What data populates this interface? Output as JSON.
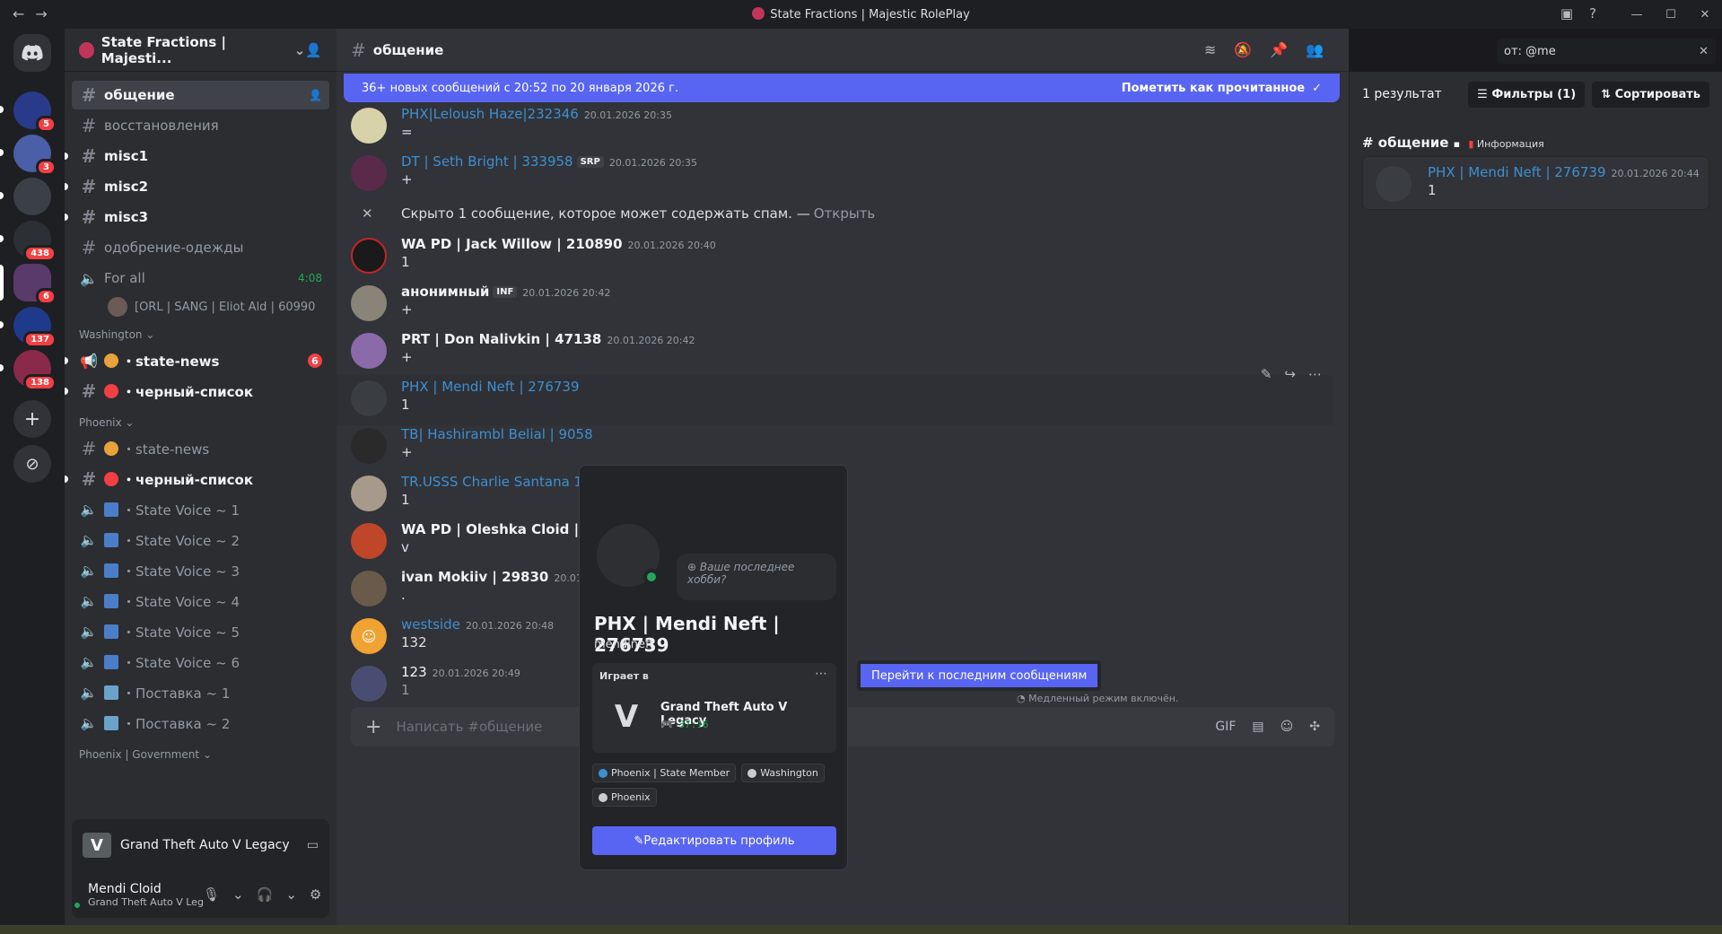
{
  "window": {
    "title": "State Fractions | Majestic RolePlay",
    "back_icon": "←",
    "forward_icon": "→",
    "minimize": "—",
    "maximize": "☐",
    "close": "✕"
  },
  "guilds": [
    {
      "badge": "5"
    },
    {
      "badge": "3"
    },
    {
      "badge": ""
    },
    {
      "badge": "438"
    },
    {
      "badge": "6"
    },
    {
      "badge": "137"
    },
    {
      "badge": "138"
    }
  ],
  "server": {
    "name": "State Fractions | Majesti...",
    "brand_color": "#c0365a"
  },
  "channels": {
    "top": [
      {
        "name": "общение",
        "state": "active"
      },
      {
        "name": "восстановления",
        "state": "read"
      },
      {
        "name": "misc1",
        "state": "unread"
      },
      {
        "name": "misc2",
        "state": "unread"
      },
      {
        "name": "misc3",
        "state": "unread"
      },
      {
        "name": "одобрение-одежды",
        "state": "read"
      }
    ],
    "voice_for_all": {
      "name": "For all",
      "timer": "4:08"
    },
    "voice_user": "[ORL | SANG | Eliot Ald | 60990",
    "cat_washington": "Washington",
    "washington": [
      {
        "name": "・state-news",
        "badge": "6"
      },
      {
        "name": "・черный-список",
        "badge": ""
      }
    ],
    "cat_phoenix": "Phoenix",
    "phoenix": [
      {
        "name": "・state-news"
      },
      {
        "name": "・черный-список"
      },
      {
        "name": "・State Voice ~ 1"
      },
      {
        "name": "・State Voice ~ 2"
      },
      {
        "name": "・State Voice ~ 3"
      },
      {
        "name": "・State Voice ~ 4"
      },
      {
        "name": "・State Voice ~ 5"
      },
      {
        "name": "・State Voice ~ 6"
      },
      {
        "name": "・Поставка ~ 1"
      },
      {
        "name": "・Поставка ~ 2"
      }
    ],
    "cat_phoenix_gov": "Phoenix | Government"
  },
  "activity_panel": {
    "game": "Grand Theft Auto V Legacy"
  },
  "user_panel": {
    "name": "Mendi Cloid",
    "status": "Grand Theft Auto V Leg"
  },
  "chat": {
    "channel": "общение",
    "new_banner": "36+ новых сообщений с 20:52 по 20 января 2026 г.",
    "mark_read": "Пометить как прочитанное",
    "messages": [
      {
        "author": "PHX|Leloush Haze|232346",
        "ts": "20.01.2026 20:35",
        "body": "=",
        "tag": ""
      },
      {
        "author": "DT | Seth Bright | 333958",
        "ts": "20.01.2026 20:35",
        "body": "+",
        "tag": "SRP"
      },
      {
        "author": "WA PD | Jack Willow | 210890",
        "ts": "20.01.2026 20:40",
        "body": "1",
        "tag": ""
      },
      {
        "author": "анонимный",
        "ts": "20.01.2026 20:42",
        "body": "+",
        "tag": "INF"
      },
      {
        "author": "PRT | Don Nalivkin | 47138",
        "ts": "20.01.2026 20:42",
        "body": "+",
        "tag": ""
      },
      {
        "author": "PHX   | Mendi Neft  | 276739",
        "ts": "",
        "body": "1",
        "tag": ""
      },
      {
        "author": "TB| Hashirambl Belial | 9058",
        "ts": "",
        "body": "+",
        "tag": ""
      },
      {
        "author": "TR.USSS Charlie Santana 182",
        "ts": "",
        "body": "1",
        "tag": ""
      },
      {
        "author": "WA PD | Oleshka Cloid | 1272",
        "ts": "",
        "body": "v",
        "tag": ""
      },
      {
        "author": "ivan Mokiiv | 29830",
        "ts": "20.01.2026",
        "body": ".",
        "tag": ""
      },
      {
        "author": "westside",
        "ts": "20.01.2026 20:48",
        "body": "132",
        "tag": ""
      },
      {
        "author": "123",
        "ts": "20.01.2026 20:49",
        "body": "1",
        "tag": ""
      }
    ],
    "spam_notice": "Скрыто 1 сообщение, которое может содержать спам. —",
    "spam_open": "Открыть",
    "slowmode": "Медленный режим включён.",
    "composer_placeholder": "Написать #общение",
    "jump_button": "Перейти к последним сообщениям"
  },
  "search": {
    "query": "от: @me",
    "results_count": "1 результат",
    "filters": "Фильтры (1)",
    "sort": "Сортировать",
    "result_channel": "общение",
    "result_category": "Информация",
    "result": {
      "author": "PHX   | Mendi Neft  | 276739",
      "ts": "20.01.2026 20:44",
      "body": "1"
    }
  },
  "profile": {
    "hobby": "Ваше последнее хобби?",
    "display_name": "PHX | Mendi Neft | 276739",
    "username": "mendineft",
    "playing_label": "Играет в",
    "game": "Grand Theft Auto V Legacy",
    "game_time": "37:16",
    "roles": [
      {
        "name": "Phoenix | State Member",
        "color": "#3e8fd0"
      },
      {
        "name": "Washington",
        "color": "#c9cdd2"
      },
      {
        "name": "Phoenix",
        "color": "#c9cdd2"
      }
    ],
    "edit_button": "Редактировать профиль"
  },
  "colors": {
    "accent": "#5865f2",
    "danger": "#f23f43",
    "online": "#23a55a",
    "link": "#3e8fd0"
  }
}
